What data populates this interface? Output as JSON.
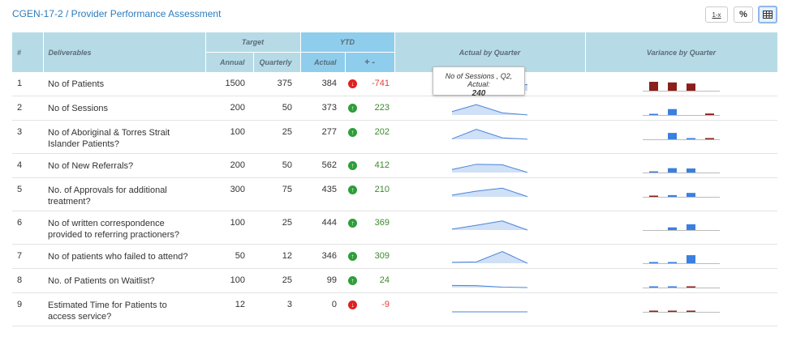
{
  "title": "CGEN-17-2 / Provider Performance Assessment",
  "toolbar": {
    "formula_label": "1-x",
    "percent_label": "%",
    "table_icon": "table-icon"
  },
  "headers": {
    "index": "#",
    "deliverables": "Deliverables",
    "target": "Target",
    "ytd": "YTD",
    "actual_by_quarter": "Actual by Quarter",
    "variance_by_quarter": "Variance by Quarter",
    "annual": "Annual",
    "quarterly": "Quarterly",
    "actual": "Actual",
    "plus_minus": "+ -"
  },
  "tooltip": {
    "label": "No of Sessions , Q2, Actual:",
    "value": "240"
  },
  "rows": [
    {
      "index": "1",
      "deliverable": "No of Patients",
      "annual": "1500",
      "quarterly": "375",
      "actual": "384",
      "trend": "down",
      "variance": "-741",
      "q_actual": [
        90,
        110,
        145,
        140
      ],
      "q_var": [
        -285,
        -265,
        -230,
        0
      ]
    },
    {
      "index": "2",
      "deliverable": "No of Sessions",
      "annual": "200",
      "quarterly": "50",
      "actual": "373",
      "trend": "up",
      "variance": "223",
      "q_actual": [
        80,
        240,
        50,
        3
      ],
      "q_var": [
        30,
        190,
        0,
        -47
      ]
    },
    {
      "index": "3",
      "deliverable": "No of Aboriginal & Torres Strait Islander Patients?",
      "annual": "100",
      "quarterly": "25",
      "actual": "277",
      "trend": "up",
      "variance": "202",
      "q_actual": [
        10,
        230,
        35,
        2
      ],
      "q_var": [
        0,
        205,
        10,
        -23
      ]
    },
    {
      "index": "4",
      "deliverable": "No of New Referrals?",
      "annual": "200",
      "quarterly": "50",
      "actual": "562",
      "trend": "up",
      "variance": "412",
      "q_actual": [
        70,
        190,
        180,
        2
      ],
      "q_var": [
        20,
        140,
        130,
        0
      ]
    },
    {
      "index": "5",
      "deliverable": "No. of Approvals for additional treatment?",
      "annual": "300",
      "quarterly": "75",
      "actual": "435",
      "trend": "up",
      "variance": "210",
      "q_actual": [
        40,
        130,
        200,
        5
      ],
      "q_var": [
        -35,
        55,
        125,
        0
      ]
    },
    {
      "index": "6",
      "deliverable": "No of written correspondence provided to referring practioners?",
      "annual": "100",
      "quarterly": "25",
      "actual": "444",
      "trend": "up",
      "variance": "369",
      "q_actual": [
        20,
        110,
        210,
        0
      ],
      "q_var": [
        0,
        85,
        185,
        0
      ]
    },
    {
      "index": "7",
      "deliverable": "No of patients who failed to attend?",
      "annual": "50",
      "quarterly": "12",
      "actual": "346",
      "trend": "up",
      "variance": "309",
      "q_actual": [
        20,
        30,
        270,
        0
      ],
      "q_var": [
        8,
        18,
        258,
        0
      ]
    },
    {
      "index": "8",
      "deliverable": "No. of Patients on Waitlist?",
      "annual": "100",
      "quarterly": "25",
      "actual": "99",
      "trend": "up",
      "variance": "24",
      "q_actual": [
        50,
        45,
        10,
        0
      ],
      "q_var": [
        25,
        20,
        -15,
        0
      ]
    },
    {
      "index": "9",
      "deliverable": "Estimated Time for Patients to access service?",
      "annual": "12",
      "quarterly": "3",
      "actual": "0",
      "trend": "down",
      "variance": "-9",
      "q_actual": [
        0,
        0,
        0,
        0
      ],
      "q_var": [
        -3,
        -3,
        -3,
        0
      ]
    }
  ],
  "colors": {
    "positive_bar": "#3b7fe0",
    "negative_bar": "#8b1f1a",
    "spark_line": "#4a84d8",
    "spark_fill": "#cfe0f7",
    "header_bg": "#b7dbe6",
    "ytd_header_bg": "#8fcdec",
    "title": "#2c7bbd"
  }
}
